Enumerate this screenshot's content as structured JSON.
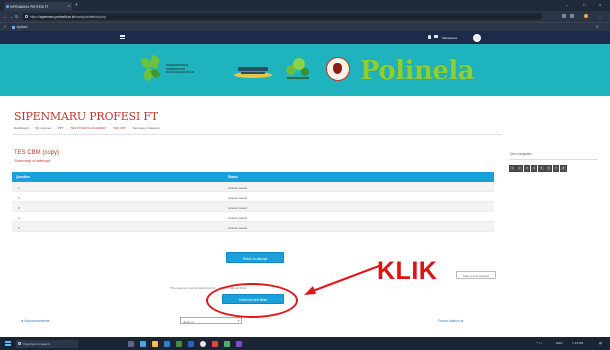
{
  "browser": {
    "tab_title": "SIPENMARU PROFESI FT",
    "new_tab": "+",
    "url_prefix": "https://",
    "url_host": "sipenmaru.profesift.ac.id",
    "url_path": "/mod/quiz/attempt.php",
    "bookmark_label": "Aplikasi"
  },
  "navbar": {
    "user_label": "Mahasiswa"
  },
  "banner": {
    "partner_text_1": "KEMENTERIAN",
    "partner_text_2": "PENDIDIKAN",
    "partner_text_3": "DAN KEBUDAYAAN",
    "brand_wordmark": "Polinela"
  },
  "page": {
    "title": "SIPENMARU PROFESI FT",
    "breadcrumbs": [
      "Dashboard",
      "My courses",
      "PPT",
      "TES POTENSI AKADEMIK",
      "TES CBT",
      "Summary of attempt"
    ]
  },
  "quiz": {
    "title": "TES CBM (copy)",
    "subtitle": "Summary of attempt",
    "columns": [
      "Question",
      "Status"
    ],
    "rows": [
      {
        "question": "1",
        "status": "Answer saved"
      },
      {
        "question": "2",
        "status": "Answer saved"
      },
      {
        "question": "3",
        "status": "Answer saved"
      },
      {
        "question": "4",
        "status": "Answer saved"
      },
      {
        "question": "5",
        "status": "Answer saved"
      }
    ],
    "return_button": "Return to attempt",
    "note": "This attempt must be submitted by ... Submit all and finish",
    "submit_button": "Submit all and finish",
    "start_new_button": "Start a new preview",
    "prev_link": "◄ Announcements",
    "jump_label": "Jump to...",
    "next_link": "Forum diskusi ►"
  },
  "sidebar": {
    "title": "Quiz navigation",
    "question_numbers": [
      "1",
      "2",
      "3",
      "4",
      "5",
      "6",
      "7",
      "8"
    ]
  },
  "annotation": {
    "text": "KLIK"
  },
  "taskbar": {
    "search_placeholder": "Type here to search",
    "time": "7:14 PM",
    "lang": "ENG"
  },
  "colors": {
    "accent_blue": "#1aa0da",
    "heading_red": "#c0392b",
    "banner_teal": "#1fb4bd",
    "navbar": "#1c2b4a",
    "annotation_red": "#e01212"
  }
}
